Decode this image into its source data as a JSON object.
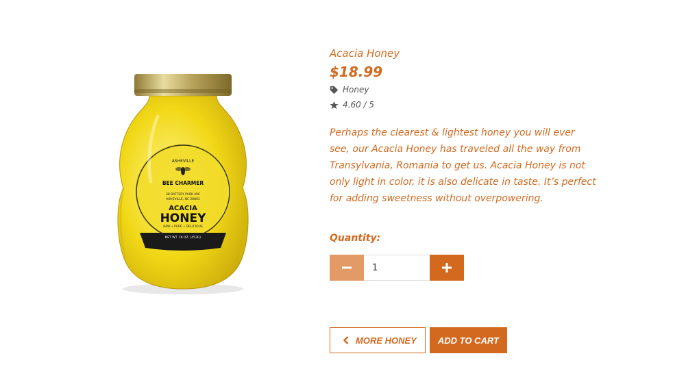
{
  "product": {
    "title": "Acacia Honey",
    "price": "$18.99",
    "category": "Honey",
    "rating": "4.60 / 5",
    "description": "Perhaps the clearest & lightest honey you will ever see, our Acacia Honey has traveled all the way from Transylvania, Romania to get us. Acacia Honey is not only light in color, it is also delicate in taste. It’s perfect for adding sweetness without overpowering."
  },
  "jar_label": {
    "town": "ASHEVILLE",
    "brand": "BEE CHARMER",
    "address_line1": "38 BATTERY PARK AVE",
    "address_line2": "ASHEVILLE, NC 28801",
    "variety_line1": "ACACIA",
    "variety_line2": "HONEY",
    "tagline": "RAW • PURE • DELICIOUS",
    "net_weight": "NET WT. 16 OZ. (453G)"
  },
  "quantity": {
    "label": "Quantity:",
    "value": "1"
  },
  "actions": {
    "more_label": "MORE HONEY",
    "cart_label": "ADD TO CART"
  },
  "colors": {
    "accent": "#d2691e",
    "accent_light": "#e29a66",
    "meta_gray": "#555555"
  },
  "icons": [
    "tag-icon",
    "star-icon",
    "minus-icon",
    "plus-icon",
    "chevron-left-icon"
  ]
}
